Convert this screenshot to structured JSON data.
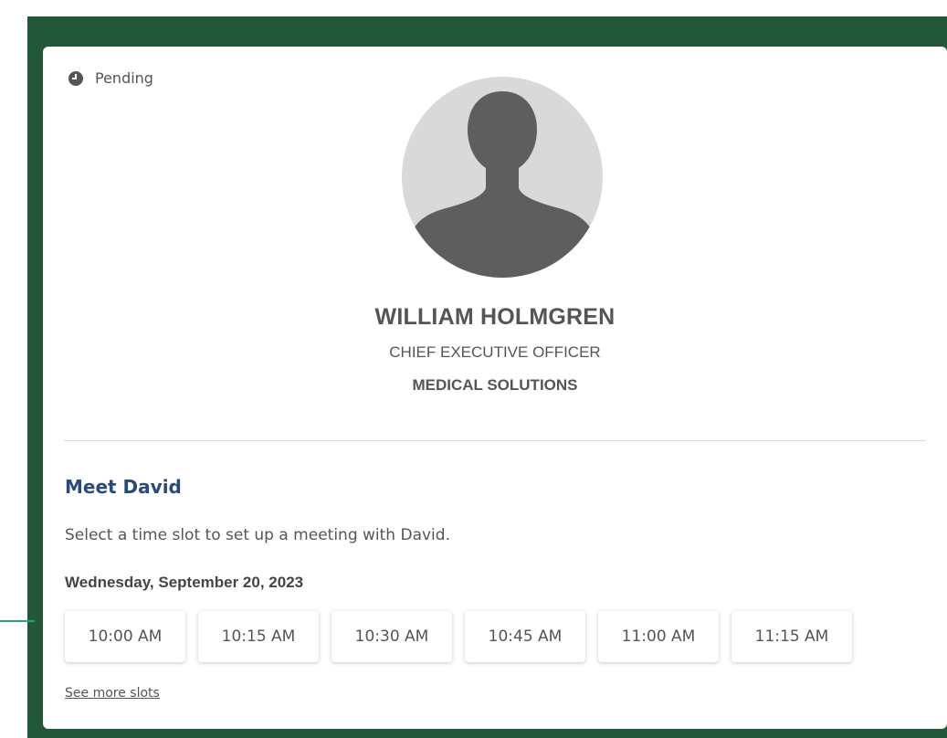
{
  "status": {
    "label": "Pending",
    "icon": "clock-icon"
  },
  "profile": {
    "name": "WILLIAM HOLMGREN",
    "title": "CHIEF EXECUTIVE OFFICER",
    "company": "MEDICAL SOLUTIONS",
    "avatar_icon": "user-silhouette-icon"
  },
  "meeting": {
    "heading": "Meet David",
    "description": "Select a time slot to set up a meeting with David.",
    "date": "Wednesday, September 20, 2023",
    "slots": [
      "10:00 AM",
      "10:15 AM",
      "10:30 AM",
      "10:45 AM",
      "11:00 AM",
      "11:15 AM"
    ],
    "see_more": "See more slots"
  },
  "colors": {
    "frame": "#22573a",
    "accent_line": "#2fa37a",
    "heading": "#2b4a7c",
    "text": "#555555",
    "avatar_bg": "#d9d9d9",
    "avatar_fg": "#5e5e5e"
  }
}
